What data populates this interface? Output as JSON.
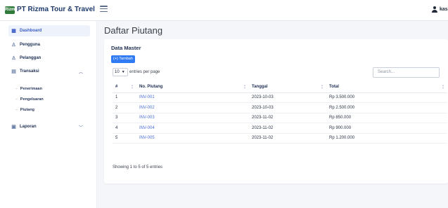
{
  "header": {
    "logo_text": "Rizma",
    "brand": "PT Rizma Tour & Travel",
    "user": "kasi"
  },
  "sidebar": {
    "items": [
      {
        "label": "Dashboard",
        "icon": "grid-icon"
      },
      {
        "label": "Pengguna",
        "icon": "user-icon"
      },
      {
        "label": "Pelanggan",
        "icon": "user-icon"
      },
      {
        "label": "Transaksi",
        "icon": "table-icon"
      },
      {
        "label": "Laporan",
        "icon": "report-icon"
      }
    ],
    "sub_items": [
      "Penerimaan",
      "Pengeluaran",
      "Piutang"
    ]
  },
  "main": {
    "page_title": "Daftar Piutang",
    "card_title": "Data Master",
    "add_button": "(+) Tambah",
    "entries_value": "10",
    "entries_label": "entries per page",
    "search_placeholder": "Search...",
    "columns": [
      "#",
      "No. Piutang",
      "Tanggal",
      "Total"
    ],
    "rows": [
      [
        "1",
        "INV-001",
        "2023-10-03",
        "Rp 3.500.000"
      ],
      [
        "2",
        "INV-002",
        "2023-10-03",
        "Rp 2.500.000"
      ],
      [
        "3",
        "INV-003",
        "2023-11-02",
        "Rp 850.000"
      ],
      [
        "4",
        "INV-004",
        "2023-11-02",
        "Rp 900.000"
      ],
      [
        "5",
        "INV-005",
        "2023-11-02",
        "Rp 1.200.000"
      ]
    ],
    "footer": "Showing 1 to 5 of 5 entries"
  },
  "colors": {
    "accent": "#2f7bf5",
    "brand": "#1e3a6b",
    "link": "#4b6fd6"
  }
}
